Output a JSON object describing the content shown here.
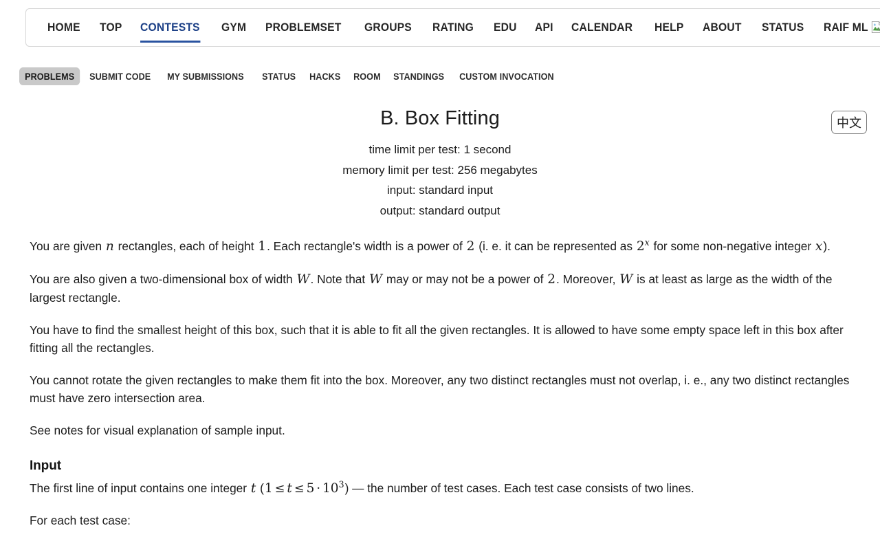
{
  "top_nav": {
    "items": [
      {
        "label": "HOME",
        "active": false
      },
      {
        "label": "TOP",
        "active": false
      },
      {
        "label": "CONTESTS",
        "active": true
      },
      {
        "label": "GYM",
        "active": false
      },
      {
        "label": "PROBLEMSET",
        "active": false
      },
      {
        "label": "GROUPS",
        "active": false
      },
      {
        "label": "RATING",
        "active": false
      },
      {
        "label": "EDU",
        "active": false
      },
      {
        "label": "API",
        "active": false
      },
      {
        "label": "CALENDAR",
        "active": false
      },
      {
        "label": "HELP",
        "active": false
      },
      {
        "label": "ABOUT",
        "active": false
      },
      {
        "label": "STATUS",
        "active": false
      },
      {
        "label": "RAIF ML",
        "active": false,
        "icon": "broken-image-icon"
      }
    ],
    "active_underline_color": "#2a53a0"
  },
  "sub_nav": {
    "items": [
      {
        "label": "PROBLEMS",
        "selected": true
      },
      {
        "label": "SUBMIT CODE",
        "selected": false
      },
      {
        "label": "MY SUBMISSIONS",
        "selected": false
      },
      {
        "label": "STATUS",
        "selected": false
      },
      {
        "label": "HACKS",
        "selected": false
      },
      {
        "label": "ROOM",
        "selected": false
      },
      {
        "label": "STANDINGS",
        "selected": false
      },
      {
        "label": "CUSTOM INVOCATION",
        "selected": false
      }
    ],
    "selected_background": "#c9c9c9"
  },
  "language_button": {
    "label": "中文"
  },
  "problem": {
    "title": "B. Box Fitting",
    "time_limit": "time limit per test: 1 second",
    "memory_limit": "memory limit per test: 256 megabytes",
    "input_spec": "input: standard input",
    "output_spec": "output: standard output",
    "paragraph1": {
      "t1": "You are given ",
      "v1": "n",
      "t2": " rectangles, each of height ",
      "v2": "1",
      "t3": ". Each rectangle's width is a power of ",
      "v3": "2",
      "t4": " (i. e. it can be represented as ",
      "v4_base": "2",
      "v4_exp": "x",
      "t5": " for some non-negative integer ",
      "v5": "x",
      "t6": ")."
    },
    "paragraph2": {
      "t1": "You are also given a two-dimensional box of width ",
      "v1": "W",
      "t2": ". Note that ",
      "v2": "W",
      "t3": " may or may not be a power of ",
      "v3": "2",
      "t4": ". Moreover, ",
      "v4": "W",
      "t5": " is at least as large as the width of the largest rectangle."
    },
    "paragraph3": "You have to find the smallest height of this box, such that it is able to fit all the given rectangles. It is allowed to have some empty space left in this box after fitting all the rectangles.",
    "paragraph4": "You cannot rotate the given rectangles to make them fit into the box. Moreover, any two distinct rectangles must not overlap, i. e., any two distinct rectangles must have zero intersection area.",
    "paragraph5": "See notes for visual explanation of sample input.",
    "input_heading": "Input",
    "input_paragraph": {
      "t1": "The first line of input contains one integer ",
      "v1": "t",
      "t2": " (",
      "c1": "1",
      "op1": "≤",
      "c2": "t",
      "op2": "≤",
      "c3": "5",
      "op3": "·",
      "c4_base": "10",
      "c4_exp": "3",
      "t3": ") — the number of test cases. Each test case consists of two lines."
    },
    "for_each_test_case": "For each test case:"
  }
}
